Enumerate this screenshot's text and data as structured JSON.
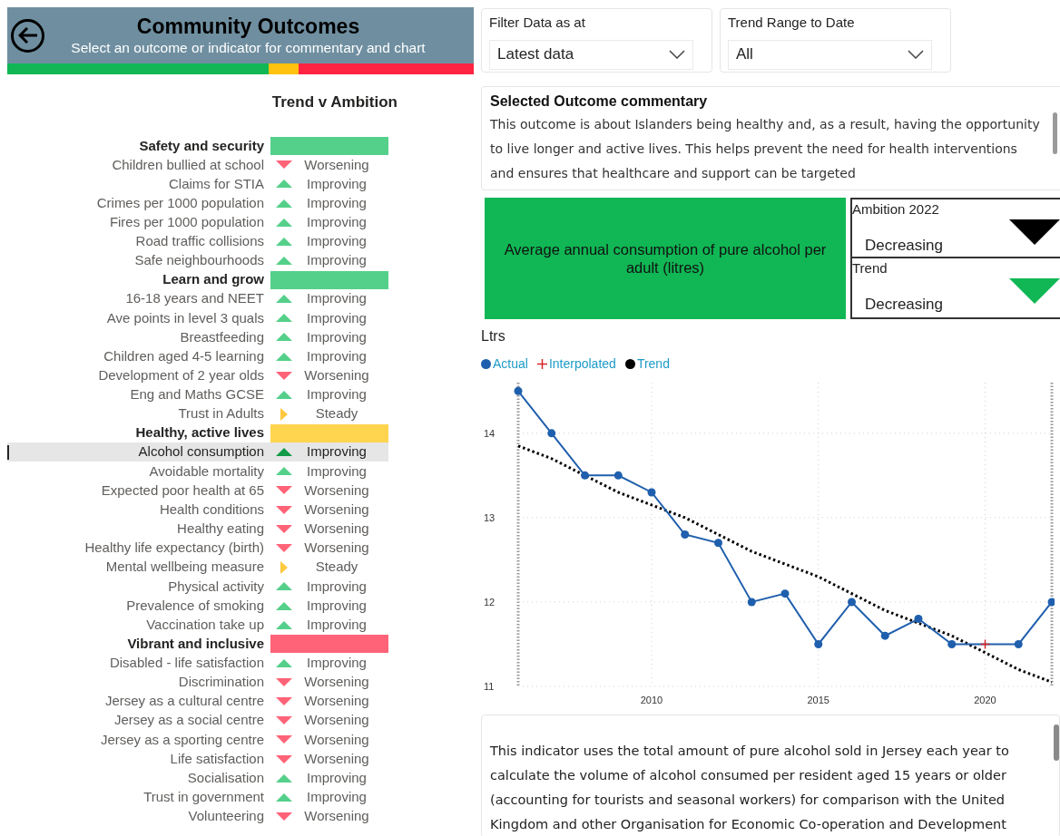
{
  "header": {
    "title": "Community Outcomes",
    "subtitle": "Select an outcome or indicator for commentary and chart"
  },
  "status_strip": [
    {
      "color": "#10b754"
    },
    {
      "color": "#ffc20e"
    },
    {
      "color": "#ff2442"
    }
  ],
  "list_heading": "Trend v Ambition",
  "groups": [
    {
      "name": "Safety and security",
      "color": "#55d08a",
      "items": [
        {
          "label": "Children bullied at school",
          "kind": "worsening",
          "status": "Worsening",
          "selected": false
        },
        {
          "label": "Claims for STIA",
          "kind": "improving",
          "status": "Improving",
          "selected": false
        },
        {
          "label": "Crimes per 1000 population",
          "kind": "improving",
          "status": "Improving",
          "selected": false
        },
        {
          "label": "Fires per 1000 population",
          "kind": "improving",
          "status": "Improving",
          "selected": false
        },
        {
          "label": "Road traffic collisions",
          "kind": "improving",
          "status": "Improving",
          "selected": false
        },
        {
          "label": "Safe neighbourhoods",
          "kind": "improving",
          "status": "Improving",
          "selected": false
        }
      ]
    },
    {
      "name": "Learn and grow",
      "color": "#55d08a",
      "items": [
        {
          "label": "16-18 years and NEET",
          "kind": "improving",
          "status": "Improving",
          "selected": false
        },
        {
          "label": "Ave points in level 3 quals",
          "kind": "improving",
          "status": "Improving",
          "selected": false
        },
        {
          "label": "Breastfeeding",
          "kind": "improving",
          "status": "Improving",
          "selected": false
        },
        {
          "label": "Children aged 4-5 learning",
          "kind": "improving",
          "status": "Improving",
          "selected": false
        },
        {
          "label": "Development of 2 year olds",
          "kind": "worsening",
          "status": "Worsening",
          "selected": false
        },
        {
          "label": "Eng and Maths GCSE",
          "kind": "improving",
          "status": "Improving",
          "selected": false
        },
        {
          "label": "Trust in Adults",
          "kind": "steady",
          "status": "Steady",
          "selected": false
        }
      ]
    },
    {
      "name": "Healthy, active lives",
      "color": "#ffd44f",
      "items": [
        {
          "label": "Alcohol consumption",
          "kind": "improving",
          "status": "Improving",
          "selected": true
        },
        {
          "label": "Avoidable mortality",
          "kind": "improving",
          "status": "Improving",
          "selected": false
        },
        {
          "label": "Expected poor health at 65",
          "kind": "worsening",
          "status": "Worsening",
          "selected": false
        },
        {
          "label": "Health conditions",
          "kind": "worsening",
          "status": "Worsening",
          "selected": false
        },
        {
          "label": "Healthy eating",
          "kind": "worsening",
          "status": "Worsening",
          "selected": false
        },
        {
          "label": "Healthy life expectancy (birth)",
          "kind": "worsening",
          "status": "Worsening",
          "selected": false
        },
        {
          "label": "Mental wellbeing measure",
          "kind": "steady",
          "status": "Steady",
          "selected": false
        },
        {
          "label": "Physical activity",
          "kind": "improving",
          "status": "Improving",
          "selected": false
        },
        {
          "label": "Prevalence of smoking",
          "kind": "improving",
          "status": "Improving",
          "selected": false
        },
        {
          "label": "Vaccination take up",
          "kind": "improving",
          "status": "Improving",
          "selected": false
        }
      ]
    },
    {
      "name": "Vibrant and inclusive",
      "color": "#ff6378",
      "items": [
        {
          "label": "Disabled - life satisfaction",
          "kind": "improving",
          "status": "Improving",
          "selected": false
        },
        {
          "label": "Discrimination",
          "kind": "worsening",
          "status": "Worsening",
          "selected": false
        },
        {
          "label": "Jersey as a cultural centre",
          "kind": "worsening",
          "status": "Worsening",
          "selected": false
        },
        {
          "label": "Jersey as a social centre",
          "kind": "worsening",
          "status": "Worsening",
          "selected": false
        },
        {
          "label": "Jersey as a sporting centre",
          "kind": "worsening",
          "status": "Worsening",
          "selected": false
        },
        {
          "label": "Life satisfaction",
          "kind": "worsening",
          "status": "Worsening",
          "selected": false
        },
        {
          "label": "Socialisation",
          "kind": "improving",
          "status": "Improving",
          "selected": false
        },
        {
          "label": "Trust in government",
          "kind": "improving",
          "status": "Improving",
          "selected": false
        },
        {
          "label": "Volunteering",
          "kind": "worsening",
          "status": "Worsening",
          "selected": false
        }
      ]
    }
  ],
  "filters": [
    {
      "label": "Filter Data as at",
      "value": "Latest data"
    },
    {
      "label": "Trend Range to Date",
      "value": "All"
    }
  ],
  "commentary": {
    "title": "Selected Outcome commentary",
    "text": "This outcome is about Islanders being healthy and, as a result, having the opportunity to live longer and active lives. This helps prevent the need for health interventions and ensures that healthcare and support can be targeted"
  },
  "indicator": {
    "title": "Average annual consumption of pure alcohol per adult (litres)",
    "color": "#10b754"
  },
  "direction_cards": [
    {
      "label": "Ambition 2022",
      "value": "Decreasing",
      "kind": "down",
      "color": "#000000"
    },
    {
      "label": "Trend",
      "value": "Decreasing",
      "kind": "down",
      "color": "#10b754"
    }
  ],
  "chart_data": {
    "type": "line",
    "ylabel": "Ltrs",
    "grid": true,
    "x": [
      2006,
      2007,
      2008,
      2009,
      2010,
      2011,
      2012,
      2013,
      2014,
      2015,
      2016,
      2017,
      2018,
      2019,
      2020,
      2021,
      2022
    ],
    "series": [
      {
        "name": "Actual",
        "color": "#1f5fad",
        "marker": "circle",
        "values": [
          14.5,
          14.0,
          13.5,
          13.5,
          13.3,
          12.8,
          12.7,
          12.0,
          12.1,
          11.5,
          12.0,
          11.6,
          11.8,
          11.5,
          null,
          11.5,
          12.0
        ]
      },
      {
        "name": "Interpolated",
        "color": "#d62728",
        "marker": "plus",
        "values": [
          null,
          null,
          null,
          null,
          null,
          null,
          null,
          null,
          null,
          null,
          null,
          null,
          null,
          null,
          11.5,
          null,
          null
        ]
      },
      {
        "name": "Trend",
        "color": "#000000",
        "line_style": "dotted",
        "values": [
          13.85,
          13.7,
          13.5,
          13.3,
          13.15,
          13.0,
          12.8,
          12.6,
          12.45,
          12.3,
          12.1,
          11.9,
          11.75,
          11.6,
          11.4,
          11.2,
          11.05
        ]
      }
    ],
    "xlim": [
      2006,
      2022
    ],
    "ylim": [
      11,
      14.6
    ],
    "xticks": [
      2010,
      2015,
      2020
    ],
    "yticks": [
      11,
      12,
      13,
      14
    ]
  },
  "indicator_note": "This indicator uses the total amount of pure alcohol sold in Jersey each year to calculate the volume of alcohol consumed per resident aged 15 years or older (accounting for tourists and seasonal workers) for comparison with the United Kingdom and other Organisation for Economic Co-operation and Development"
}
